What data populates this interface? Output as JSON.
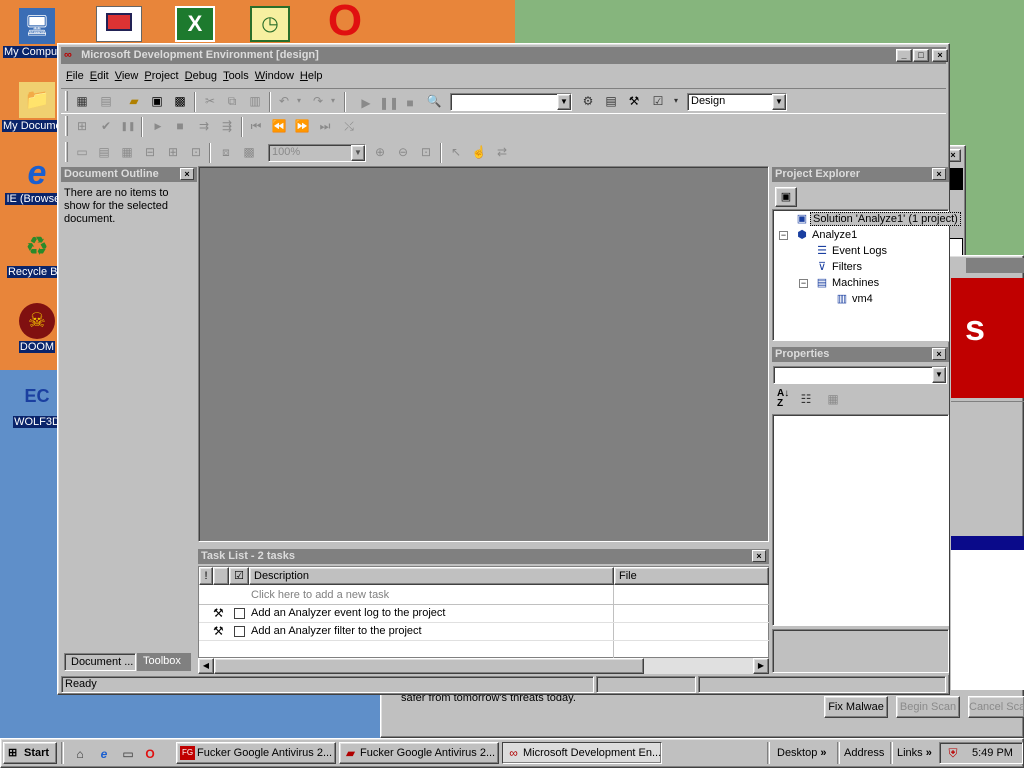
{
  "desktop": {
    "icons": [
      {
        "label": "My Computer",
        "glyph": "🖥"
      },
      {
        "label": "My Documents",
        "glyph": "📁"
      },
      {
        "label": "IE (Browser)",
        "glyph": "e"
      },
      {
        "label": "Recycle Bin",
        "glyph": "♻"
      },
      {
        "label": "DOOM",
        "glyph": "☠"
      },
      {
        "label": "WOLF3D",
        "glyph": "EC"
      }
    ],
    "top_icons": [
      "outlook-icon",
      "excel-icon",
      "project-icon",
      "opera-icon"
    ],
    "bg_colors": {
      "orange": "#e8853a",
      "green": "#7cb37a",
      "blue": "#5f8fc9"
    }
  },
  "window": {
    "title": "Microsoft Development Environment [design]",
    "menu": [
      "File",
      "Edit",
      "View",
      "Project",
      "Debug",
      "Tools",
      "Window",
      "Help"
    ],
    "config_value": "Design",
    "zoom_value": "100%",
    "status": "Ready"
  },
  "document_outline": {
    "title": "Document Outline",
    "message": "There are no items to show for the selected document.",
    "tabs": [
      "Document ...",
      "Toolbox"
    ]
  },
  "project_explorer": {
    "title": "Project Explorer",
    "tree": [
      {
        "label": "Solution 'Analyze1' (1 project)",
        "icon": "solution-icon",
        "level": 0,
        "expander": ""
      },
      {
        "label": "Analyze1",
        "icon": "project-icon",
        "level": 0,
        "expander": "−"
      },
      {
        "label": "Event Logs",
        "icon": "eventlog-icon",
        "level": 1,
        "expander": ""
      },
      {
        "label": "Filters",
        "icon": "filter-icon",
        "level": 1,
        "expander": ""
      },
      {
        "label": "Machines",
        "icon": "machines-icon",
        "level": 1,
        "expander": "−"
      },
      {
        "label": "vm4",
        "icon": "computer-icon",
        "level": 2,
        "expander": ""
      }
    ]
  },
  "properties": {
    "title": "Properties"
  },
  "task_list": {
    "title": "Task List - 2 tasks",
    "columns": {
      "priority": "!",
      "done": "☑",
      "description": "Description",
      "file": "File"
    },
    "placeholder": "Click here to add a new task",
    "tasks": [
      {
        "description": "Add an Analyzer event log to the project",
        "file": ""
      },
      {
        "description": "Add an Analyzer filter to the project",
        "file": ""
      }
    ]
  },
  "background_dialog": {
    "text": "safer from tomorrow's threats today.",
    "buttons": [
      "Fix Malwae",
      "Begin Scan",
      "Cancel Sca"
    ]
  },
  "taskbar": {
    "start": "Start",
    "buttons": [
      {
        "label": "Fucker Google Antivirus 2...",
        "icon": "antivirus-icon"
      },
      {
        "label": "Fucker Google Antivirus 2...",
        "icon": "folder-icon"
      },
      {
        "label": "Microsoft Development En...",
        "icon": "devenv-icon"
      }
    ],
    "toolbars": [
      "Desktop",
      "Address",
      "Links"
    ],
    "time": "5:49 PM"
  }
}
